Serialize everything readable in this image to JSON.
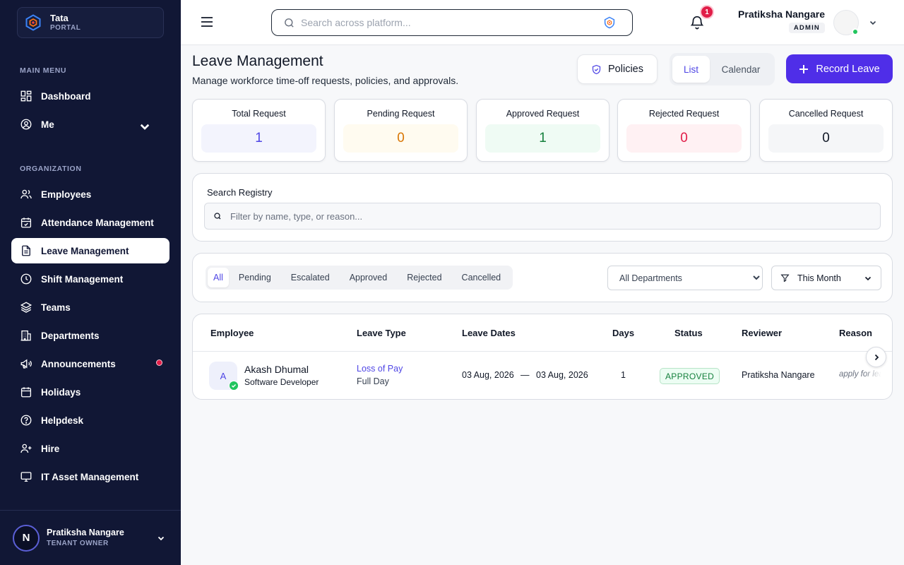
{
  "brand": {
    "name": "Tata",
    "sub": "PORTAL"
  },
  "sidebar": {
    "main_menu_label": "MAIN MENU",
    "org_label": "ORGANIZATION",
    "items": [
      {
        "label": "Dashboard",
        "icon": "dashboard-icon"
      },
      {
        "label": "Me",
        "icon": "user-circle-icon"
      },
      {
        "label": "Employees",
        "icon": "users-icon"
      },
      {
        "label": "Attendance Management",
        "icon": "calendar-check-icon"
      },
      {
        "label": "Leave Management",
        "icon": "document-icon",
        "active": true
      },
      {
        "label": "Shift Management",
        "icon": "clock-icon"
      },
      {
        "label": "Teams",
        "icon": "layers-icon"
      },
      {
        "label": "Departments",
        "icon": "building-icon"
      },
      {
        "label": "Announcements",
        "icon": "megaphone-icon"
      },
      {
        "label": "Holidays",
        "icon": "calendar-icon"
      },
      {
        "label": "Helpdesk",
        "icon": "help-circle-icon"
      },
      {
        "label": "Hire",
        "icon": "user-plus-icon"
      },
      {
        "label": "IT Asset Management",
        "icon": "monitor-icon"
      }
    ],
    "footer_user": {
      "initial": "N",
      "name": "Pratiksha Nangare",
      "role": "TENANT OWNER"
    }
  },
  "topbar": {
    "search_placeholder": "Search across platform...",
    "notification_count": "1",
    "user_name": "Pratiksha Nangare",
    "user_role": "ADMIN"
  },
  "page": {
    "title": "Leave Management",
    "subtitle": "Manage workforce time-off requests, policies, and approvals.",
    "policies_label": "Policies",
    "view_list": "List",
    "view_calendar": "Calendar",
    "record_label": "Record Leave"
  },
  "stats": [
    {
      "label": "Total Request",
      "value": "1",
      "color": "#4f46e5",
      "bg": "#f3f4fd"
    },
    {
      "label": "Pending Request",
      "value": "0",
      "color": "#d97706",
      "bg": "#fffbf0"
    },
    {
      "label": "Approved Request",
      "value": "1",
      "color": "#15803d",
      "bg": "#effbf4"
    },
    {
      "label": "Rejected Request",
      "value": "0",
      "color": "#e11d48",
      "bg": "#fff1f3"
    },
    {
      "label": "Cancelled Request",
      "value": "0",
      "color": "#111827",
      "bg": "#f5f6f8"
    }
  ],
  "registry": {
    "label": "Search Registry",
    "placeholder": "Filter by name, type, or reason..."
  },
  "filters": {
    "tabs": [
      "All",
      "Pending",
      "Escalated",
      "Approved",
      "Rejected",
      "Cancelled"
    ],
    "active_tab": "All",
    "department": "All Departments",
    "period": "This Month"
  },
  "table": {
    "headers": [
      "Employee",
      "Leave Type",
      "Leave Dates",
      "Days",
      "Status",
      "Reviewer",
      "Reason"
    ],
    "rows": [
      {
        "initial": "A",
        "name": "Akash Dhumal",
        "role": "Software Developer",
        "leave_type": "Loss of Pay",
        "duration": "Full Day",
        "start": "03 Aug, 2026",
        "separator": "—",
        "end": "03 Aug, 2026",
        "days": "1",
        "status": "APPROVED",
        "reviewer": "Pratiksha Nangare",
        "reason": "apply for leave"
      }
    ]
  },
  "colors": {
    "sidebar_bg": "#111735",
    "accent": "#4f2ee8",
    "approved": "#15803d",
    "alert": "#e11d48"
  }
}
